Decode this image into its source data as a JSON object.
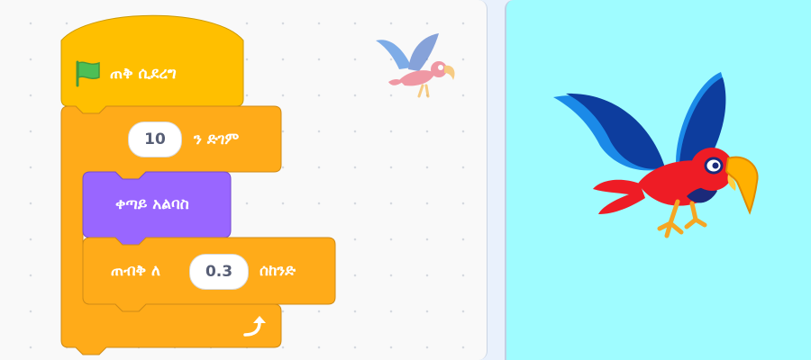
{
  "code_area": {
    "script": {
      "hat_block": {
        "label": "ጠቅ ሲደረግ",
        "icon": "green-flag-icon"
      },
      "repeat_block": {
        "count": "10",
        "label": "ን ድገም"
      },
      "next_costume_block": {
        "label": "ቀጣይ አልባስ"
      },
      "wait_block": {
        "label_before": "ጠብቅ ለ",
        "seconds": "0.3",
        "label_after": "ሰከንድ"
      },
      "loop_end": {
        "icon": "loop-arrow-icon"
      }
    },
    "sprite_thumbnail": {
      "icon": "parrot-sprite-icon"
    }
  },
  "stage": {
    "background_color": "#9ffcff",
    "sprite": "parrot"
  },
  "colors": {
    "events_yellow": "#ffbf00",
    "control_orange": "#ffab19",
    "looks_purple": "#9966ff"
  }
}
